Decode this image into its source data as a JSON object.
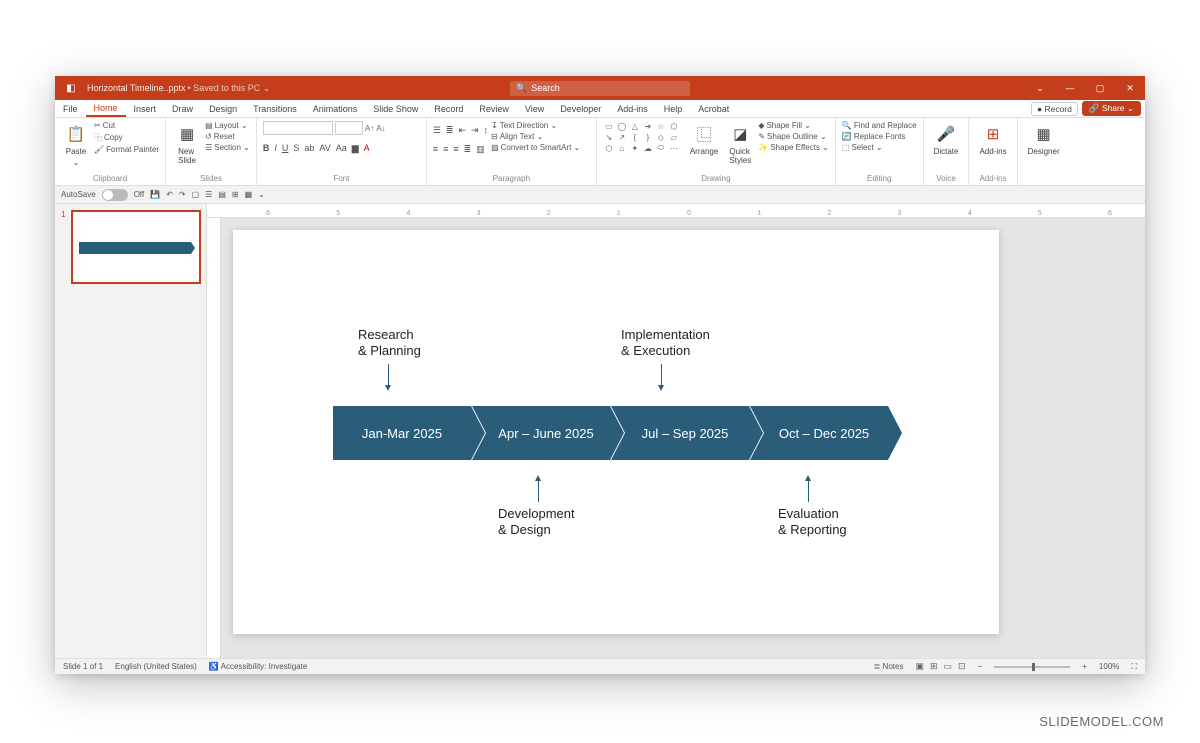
{
  "title_bar": {
    "doc": "Horizontal Timeline..pptx",
    "saved": "• Saved to this PC ⌄",
    "search_placeholder": "Search"
  },
  "tabs": [
    "File",
    "Home",
    "Insert",
    "Draw",
    "Design",
    "Transitions",
    "Animations",
    "Slide Show",
    "Record",
    "Review",
    "View",
    "Developer",
    "Add-ins",
    "Help",
    "Acrobat"
  ],
  "tabs_active": "Home",
  "record_btn": "● Record",
  "share_btn": "Share",
  "ribbon": {
    "clipboard": {
      "label": "Clipboard",
      "paste": "Paste",
      "cut": "Cut",
      "copy": "Copy",
      "painter": "Format Painter"
    },
    "slides": {
      "label": "Slides",
      "new": "New\nSlide",
      "layout": "Layout ⌄",
      "reset": "Reset",
      "section": "Section ⌄"
    },
    "font": {
      "label": "Font"
    },
    "paragraph": {
      "label": "Paragraph",
      "dir": "Text Direction ⌄",
      "align": "Align Text ⌄",
      "smart": "Convert to SmartArt ⌄"
    },
    "drawing": {
      "label": "Drawing",
      "arrange": "Arrange",
      "quick": "Quick\nStyles",
      "fill": "Shape Fill ⌄",
      "outline": "Shape Outline ⌄",
      "effects": "Shape Effects ⌄"
    },
    "editing": {
      "label": "Editing",
      "find": "Find and Replace",
      "replace": "Replace Fonts",
      "select": "Select ⌄"
    },
    "voice": {
      "label": "Voice",
      "dictate": "Dictate"
    },
    "addins": {
      "label": "Add-ins",
      "addins": "Add-ins"
    },
    "designer": {
      "label": "",
      "designer": "Designer"
    }
  },
  "qat": {
    "autosave": "AutoSave",
    "off": "Off"
  },
  "thumb_number": "1",
  "timeline": {
    "segments": [
      "Jan-Mar 2025",
      "Apr – June 2025",
      "Jul – Sep 2025",
      "Oct – Dec 2025"
    ],
    "top_callouts": [
      {
        "line1": "Research",
        "line2": "& Planning"
      },
      {
        "line1": "Implementation",
        "line2": "& Execution"
      }
    ],
    "bottom_callouts": [
      {
        "line1": "Development",
        "line2": "& Design"
      },
      {
        "line1": "Evaluation",
        "line2": "& Reporting"
      }
    ]
  },
  "status": {
    "slide": "Slide 1 of 1",
    "lang": "English (United States)",
    "access": "Accessibility: Investigate",
    "notes": "Notes",
    "zoom": "100%"
  },
  "watermark": "SLIDEMODEL.COM",
  "ruler_labels": [
    "6",
    "5",
    "4",
    "3",
    "2",
    "1",
    "0",
    "1",
    "2",
    "3",
    "4",
    "5",
    "6"
  ]
}
